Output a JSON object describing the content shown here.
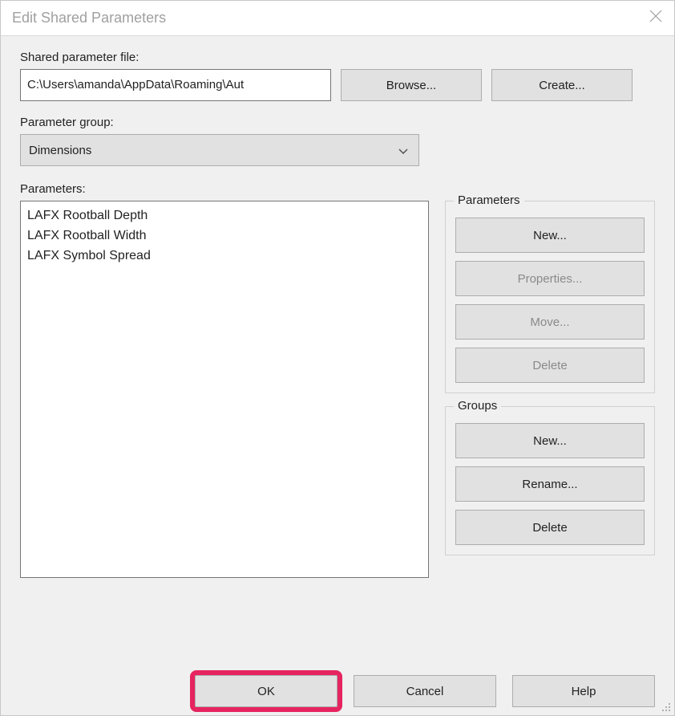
{
  "window": {
    "title": "Edit Shared Parameters"
  },
  "file": {
    "label": "Shared parameter file:",
    "path": "C:\\Users\\amanda\\AppData\\Roaming\\Aut",
    "browse": "Browse...",
    "create": "Create..."
  },
  "group": {
    "label": "Parameter group:",
    "selected": "Dimensions"
  },
  "parameters": {
    "label": "Parameters:",
    "items": [
      "LAFX Rootball Depth",
      "LAFX Rootball Width",
      "LAFX Symbol Spread"
    ]
  },
  "side": {
    "parameters": {
      "legend": "Parameters",
      "new": "New...",
      "properties": "Properties...",
      "move": "Move...",
      "delete": "Delete"
    },
    "groups": {
      "legend": "Groups",
      "new": "New...",
      "rename": "Rename...",
      "delete": "Delete"
    }
  },
  "buttons": {
    "ok": "OK",
    "cancel": "Cancel",
    "help": "Help"
  }
}
